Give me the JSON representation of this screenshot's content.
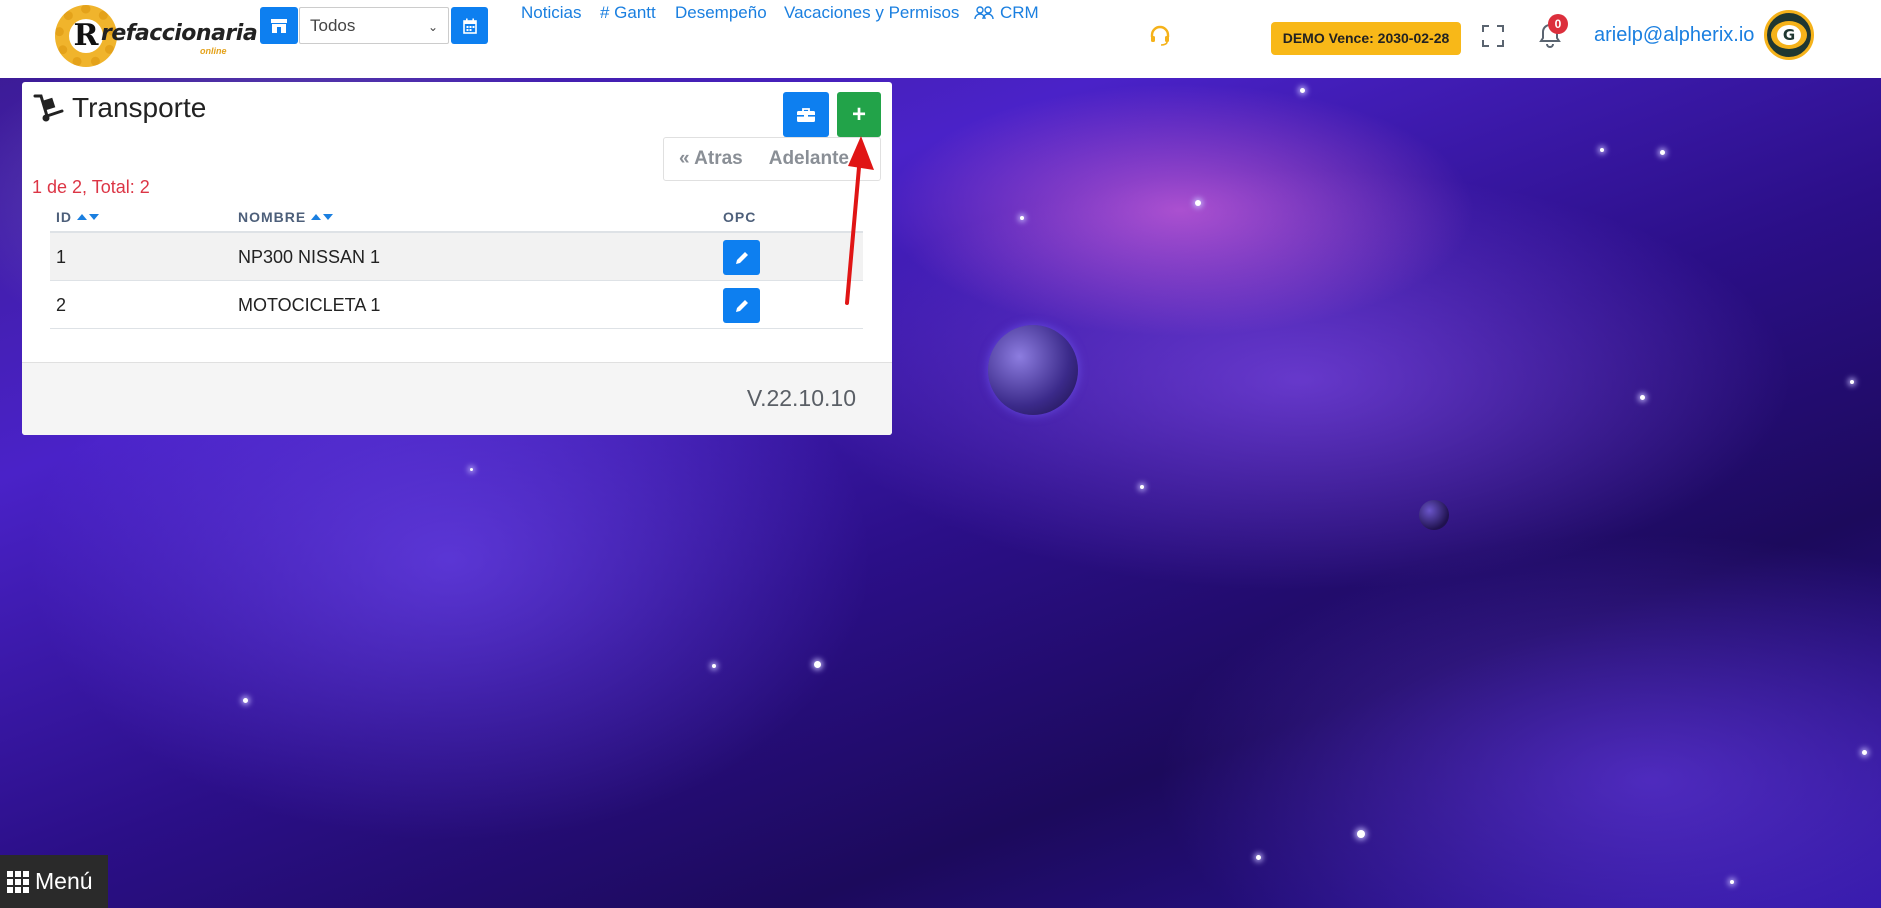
{
  "header": {
    "logo": {
      "brand": "refaccionaria",
      "sub": "online",
      "letter": "R"
    },
    "store_select": {
      "value": "Todos"
    },
    "nav": [
      "Noticias",
      "# Gantt",
      "Desempeño",
      "Vacaciones y Permisos",
      "CRM"
    ],
    "demo_badge": "DEMO Vence: 2030-02-28",
    "notifications": "0",
    "user_email": "arielp@alpherix.io",
    "avatar_letter": "G"
  },
  "card": {
    "title": "Transporte",
    "title_icon": "dolly-icon",
    "tool_button_icon": "toolbox-icon",
    "add_button": "+",
    "pager": {
      "back": "« Atras",
      "next": "Adelante"
    },
    "count_text": "1 de 2, Total: 2",
    "columns": [
      "ID",
      "NOMBRE",
      "OPC"
    ],
    "rows": [
      {
        "id": "1",
        "nombre": "NP300 NISSAN 1"
      },
      {
        "id": "2",
        "nombre": "MOTOCICLETA 1"
      }
    ],
    "version": "V.22.10.10"
  },
  "menu_button": "Menú",
  "colors": {
    "primary": "#0d7ff0",
    "success": "#22a349",
    "warning": "#f8b818",
    "danger": "#dc3545",
    "link": "#1a7fe0"
  }
}
